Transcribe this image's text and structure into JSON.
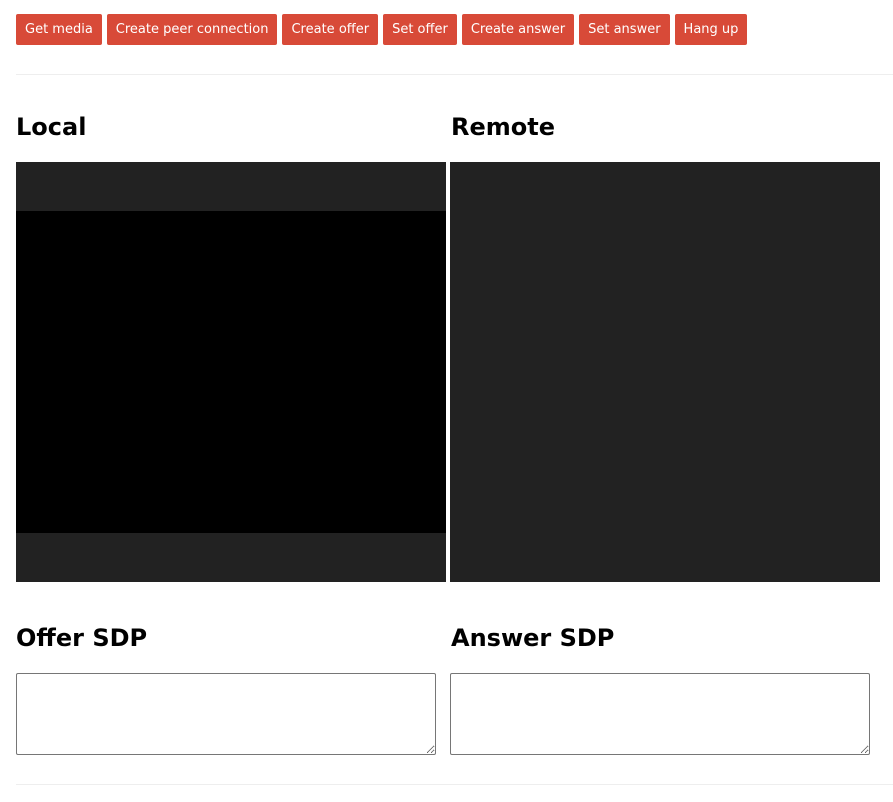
{
  "toolbar": {
    "buttons": [
      {
        "label": "Get media"
      },
      {
        "label": "Create peer connection"
      },
      {
        "label": "Create offer"
      },
      {
        "label": "Set offer"
      },
      {
        "label": "Create answer"
      },
      {
        "label": "Set answer"
      },
      {
        "label": "Hang up"
      }
    ]
  },
  "local": {
    "heading": "Local"
  },
  "remote": {
    "heading": "Remote"
  },
  "offer": {
    "heading": "Offer SDP",
    "value": ""
  },
  "answer": {
    "heading": "Answer SDP",
    "value": ""
  },
  "colors": {
    "button_bg": "#d84a38",
    "button_text": "#ffffff",
    "video_bg": "#222222",
    "video_frame": "#000000"
  }
}
